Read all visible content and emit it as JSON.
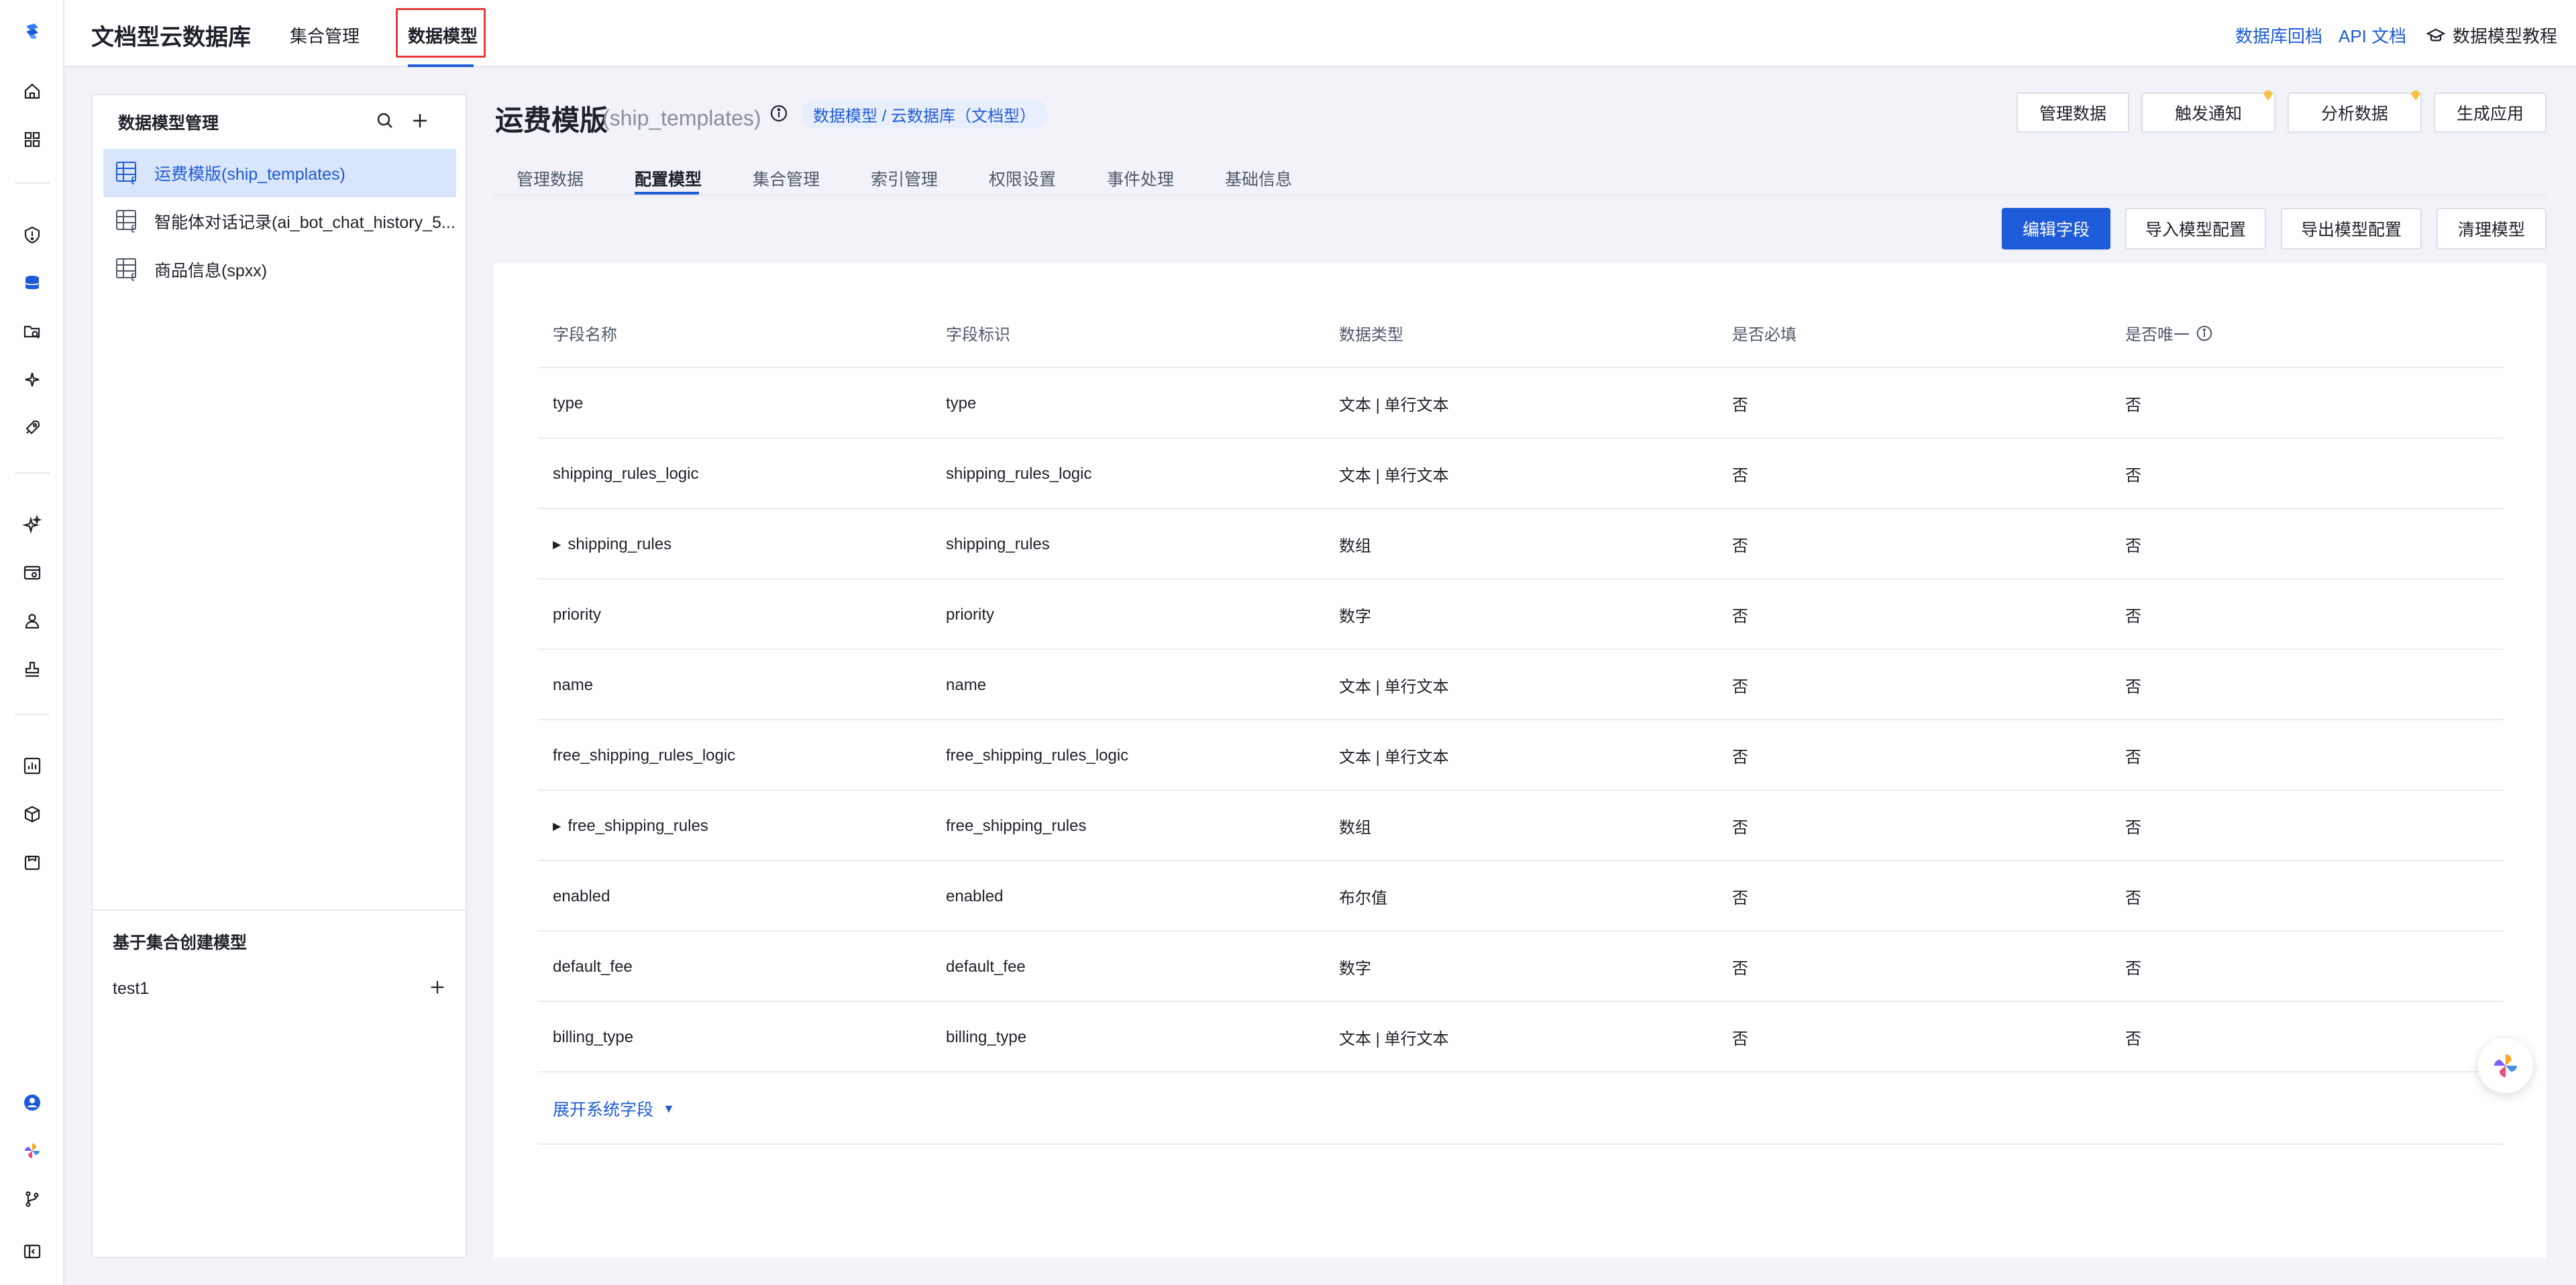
{
  "header": {
    "app_title": "文档型云数据库",
    "tabs": [
      {
        "label": "集合管理",
        "active": false
      },
      {
        "label": "数据模型",
        "active": true
      }
    ],
    "links": {
      "db_rollback": "数据库回档",
      "api_docs": "API 文档",
      "tutorial": "数据模型教程"
    }
  },
  "rail_icons": [
    "home-icon",
    "dashboard-icon",
    "shield-icon",
    "database-icon",
    "folder-search-icon",
    "sparkle-icon",
    "rocket-icon",
    "ai-sparkle-icon",
    "web-settings-icon",
    "users-icon",
    "stamp-icon",
    "chart-icon",
    "cube-icon",
    "package-icon",
    "user-avatar-icon",
    "pinwheel-icon",
    "git-branch-icon",
    "collapse-sidebar-icon"
  ],
  "sidebar": {
    "title": "数据模型管理",
    "models": [
      {
        "label": "运费模版(ship_templates)",
        "active": true
      },
      {
        "label": "智能体对话记录(ai_bot_chat_history_5...",
        "active": false
      },
      {
        "label": "商品信息(spxx)",
        "active": false
      }
    ],
    "collection_section_title": "基于集合创建模型",
    "collections": [
      "test1"
    ]
  },
  "model": {
    "title": "运费模版",
    "identifier": "(ship_templates)",
    "path_badge": "数据模型 / 云数据库（文档型）"
  },
  "header_buttons": [
    "管理数据",
    "触发通知",
    "分析数据",
    "生成应用"
  ],
  "sub_tabs": [
    {
      "label": "管理数据",
      "active": false
    },
    {
      "label": "配置模型",
      "active": true
    },
    {
      "label": "集合管理",
      "active": false
    },
    {
      "label": "索引管理",
      "active": false
    },
    {
      "label": "权限设置",
      "active": false
    },
    {
      "label": "事件处理",
      "active": false
    },
    {
      "label": "基础信息",
      "active": false
    }
  ],
  "actions": {
    "edit_fields": "编辑字段",
    "import_config": "导入模型配置",
    "export_config": "导出模型配置",
    "clear_model": "清理模型"
  },
  "table": {
    "columns": [
      "字段名称",
      "字段标识",
      "数据类型",
      "是否必填",
      "是否唯一"
    ],
    "rows": [
      {
        "name": "type",
        "id": "type",
        "type": "文本 | 单行文本",
        "required": "否",
        "unique": "否",
        "expandable": false
      },
      {
        "name": "shipping_rules_logic",
        "id": "shipping_rules_logic",
        "type": "文本 | 单行文本",
        "required": "否",
        "unique": "否",
        "expandable": false
      },
      {
        "name": "shipping_rules",
        "id": "shipping_rules",
        "type": "数组",
        "required": "否",
        "unique": "否",
        "expandable": true
      },
      {
        "name": "priority",
        "id": "priority",
        "type": "数字",
        "required": "否",
        "unique": "否",
        "expandable": false
      },
      {
        "name": "name",
        "id": "name",
        "type": "文本 | 单行文本",
        "required": "否",
        "unique": "否",
        "expandable": false
      },
      {
        "name": "free_shipping_rules_logic",
        "id": "free_shipping_rules_logic",
        "type": "文本 | 单行文本",
        "required": "否",
        "unique": "否",
        "expandable": false
      },
      {
        "name": "free_shipping_rules",
        "id": "free_shipping_rules",
        "type": "数组",
        "required": "否",
        "unique": "否",
        "expandable": true
      },
      {
        "name": "enabled",
        "id": "enabled",
        "type": "布尔值",
        "required": "否",
        "unique": "否",
        "expandable": false
      },
      {
        "name": "default_fee",
        "id": "default_fee",
        "type": "数字",
        "required": "否",
        "unique": "否",
        "expandable": false
      },
      {
        "name": "billing_type",
        "id": "billing_type",
        "type": "文本 | 单行文本",
        "required": "否",
        "unique": "否",
        "expandable": false
      }
    ],
    "expand_system_fields": "展开系统字段"
  },
  "colors": {
    "primary": "#1e5bd8",
    "highlight_border": "#e23b3b",
    "active_item_bg": "#d9e5fb"
  }
}
